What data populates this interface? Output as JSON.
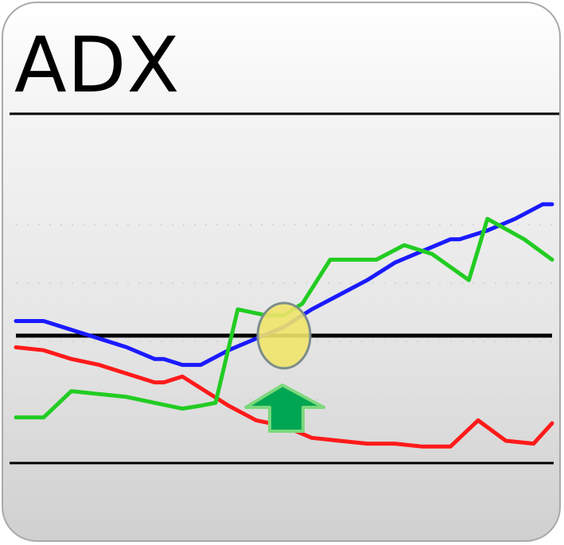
{
  "title": "ADX",
  "chart_data": {
    "type": "line",
    "title": "ADX",
    "xlabel": "",
    "ylabel": "",
    "x": [
      0,
      1,
      2,
      3,
      4,
      5,
      6,
      7,
      8,
      9,
      10,
      11,
      12,
      13,
      14,
      15,
      16,
      17,
      18,
      19,
      20,
      21,
      22,
      23,
      24,
      25,
      26,
      27,
      28,
      29
    ],
    "xlim": [
      0,
      29
    ],
    "ylim": [
      0,
      100
    ],
    "grid": true,
    "reference_line": 42,
    "series": [
      {
        "color": "#1a1aff",
        "values": [
          47,
          47,
          44,
          41,
          38,
          34,
          34,
          32,
          32,
          37,
          41,
          45,
          51,
          56,
          61,
          67,
          71,
          75,
          75,
          78,
          82,
          87,
          87
        ]
      },
      {
        "color": "#ff1a1a",
        "values": [
          38,
          37,
          34,
          32,
          29,
          26,
          26,
          28,
          24,
          18,
          13,
          11,
          7,
          6,
          5,
          5,
          4,
          4,
          13,
          6,
          5,
          12
        ]
      },
      {
        "color": "#22cc22",
        "values": [
          14,
          14,
          23,
          22,
          21,
          19,
          17,
          18,
          19,
          51,
          49,
          49,
          53,
          68,
          68,
          68,
          73,
          70,
          61,
          82,
          75,
          68
        ]
      }
    ],
    "series_x": [
      [
        0,
        1.5,
        3,
        4.5,
        6,
        7.5,
        8,
        9,
        10,
        11.5,
        13,
        14.5,
        16,
        17.5,
        19,
        20.5,
        22,
        23.5,
        24,
        25.5,
        27,
        28.5,
        29
      ],
      [
        0,
        1.5,
        3,
        4.5,
        6,
        7.5,
        8,
        9,
        10,
        11.5,
        13,
        14.5,
        16,
        17.5,
        19,
        20.5,
        22,
        23.5,
        25,
        26.5,
        28,
        29
      ],
      [
        0,
        1.5,
        3,
        4.5,
        6,
        7.5,
        9,
        10,
        10.8,
        12,
        13.5,
        14.5,
        15.5,
        17,
        18.5,
        19.5,
        21,
        22.5,
        24.5,
        25.5,
        27.5,
        29
      ]
    ],
    "highlight": {
      "x": 14.5,
      "y": 42,
      "color": "#f0e46a"
    },
    "arrow_color": "#00a651"
  }
}
